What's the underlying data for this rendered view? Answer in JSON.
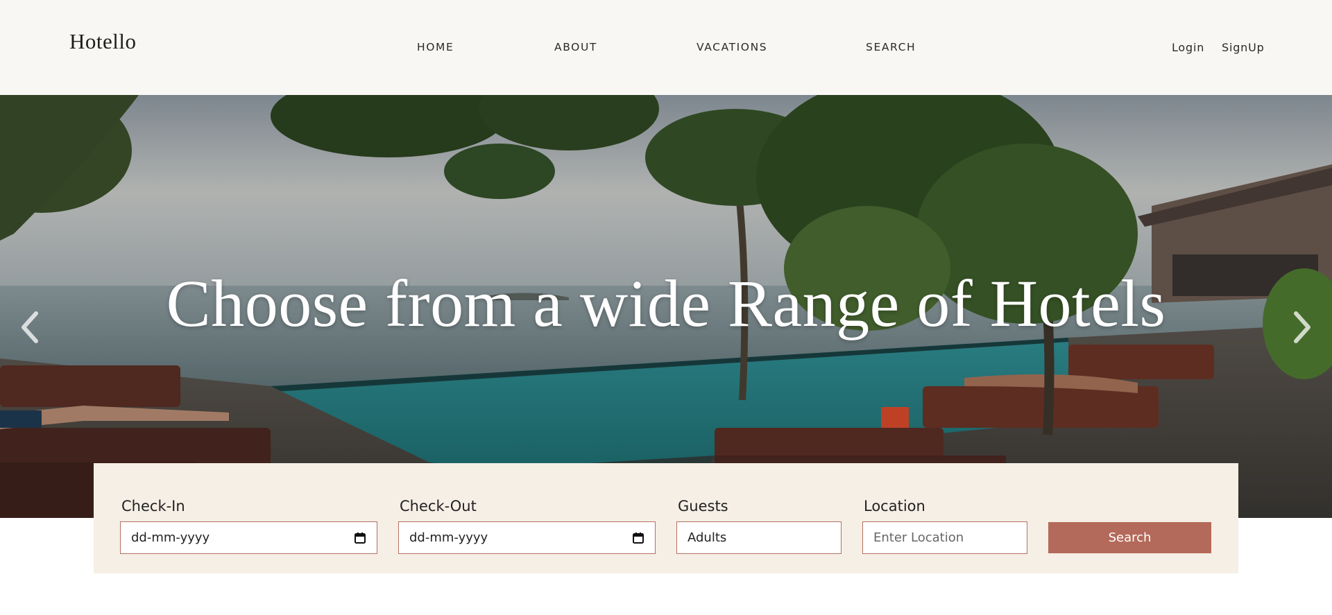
{
  "header": {
    "brand": "Hotello",
    "nav": [
      "HOME",
      "ABOUT",
      "VACATIONS",
      "SEARCH"
    ],
    "login": "Login",
    "signup": "SignUp"
  },
  "hero": {
    "title": "Choose from a wide Range of Hotels",
    "prev_icon": "chevron-left-icon",
    "next_icon": "chevron-right-icon"
  },
  "booking": {
    "checkin_label": "Check-In",
    "checkin_value": "dd-mm-yyyy",
    "checkout_label": "Check-Out",
    "checkout_value": "dd-mm-yyyy",
    "guests_label": "Guests",
    "guests_value": "Adults",
    "location_label": "Location",
    "location_placeholder": "Enter Location",
    "search_label": "Search"
  },
  "colors": {
    "header_bg": "#f9f7f3",
    "form_bg": "#f6efe6",
    "accent": "#b46a5a",
    "field_border": "#b5705f"
  }
}
